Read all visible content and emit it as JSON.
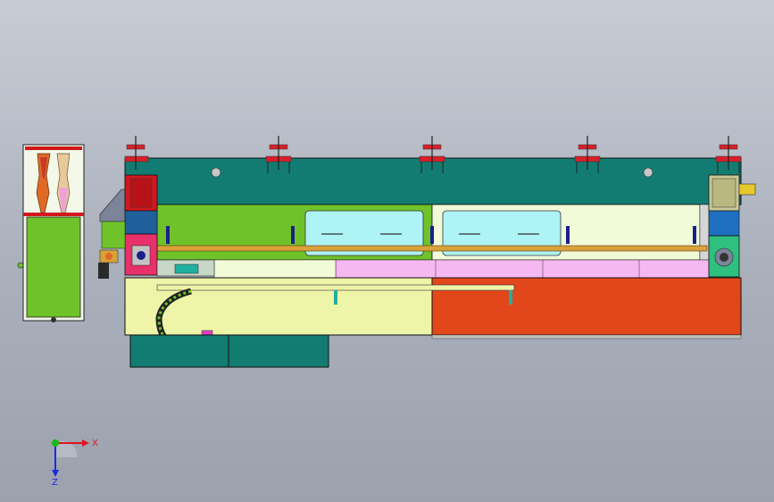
{
  "axis_triad": {
    "x_label": "X",
    "z_label": "Z",
    "colors": {
      "x": "#e0141e",
      "y": "#18b818",
      "z": "#1a2ae0"
    }
  },
  "palette": {
    "teal": "#127c72",
    "lime": "#6fc22a",
    "pale_yellow": "#eef5a8",
    "pale_green": "#f1fbd8",
    "cyan": "#aef3f6",
    "pink": "#f6b8f0",
    "orange": "#e2471b",
    "red": "#d2171d",
    "olive": "#c8c896",
    "magenta": "#e040c8",
    "brass": "#d9a23a",
    "navy": "#1a1f8c"
  }
}
